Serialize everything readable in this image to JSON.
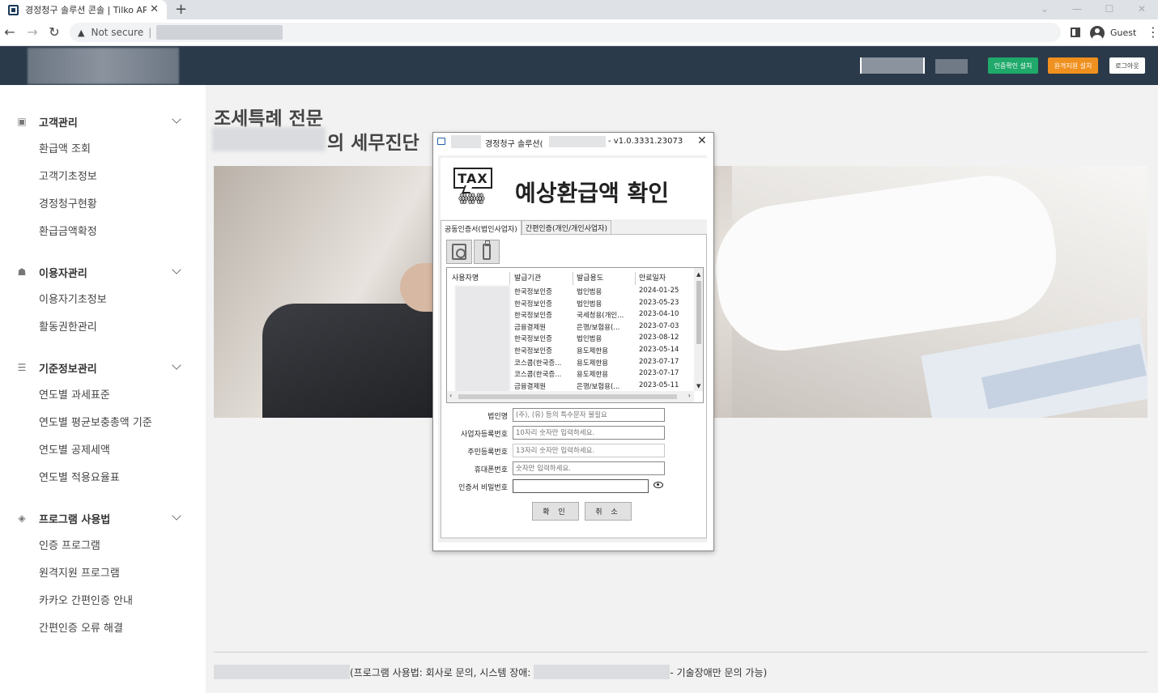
{
  "browser": {
    "tab_title": "경정청구 솔루션 콘솔 | Tilko API",
    "security_label": "Not secure",
    "profile_label": "Guest"
  },
  "header": {
    "buttons": {
      "cert_install": "인증확인 설치",
      "remote_install": "원격지원 설치",
      "logout": "로그아웃"
    },
    "colors": {
      "bg": "#2b3a4a",
      "green": "#1fa96a",
      "orange": "#f0901e"
    }
  },
  "sidebar": {
    "groups": [
      {
        "title": "고객관리",
        "icon": "person-icon",
        "items": [
          "환급액 조회",
          "고객기초정보",
          "경정청구현황",
          "환급금액확정"
        ]
      },
      {
        "title": "이용자관리",
        "icon": "users-icon",
        "items": [
          "이용자기초정보",
          "활동권한관리"
        ]
      },
      {
        "title": "기준정보관리",
        "icon": "list-icon",
        "items": [
          "연도별 과세표준",
          "연도별 평균보충총액 기준",
          "연도별 공제세액",
          "연도별 적용요율표"
        ]
      },
      {
        "title": "프로그램 사용법",
        "icon": "box-icon",
        "items": [
          "인증 프로그램",
          "원격지원 프로그램",
          "카카오 간편인증 안내",
          "간편인증 오류 해결"
        ]
      }
    ]
  },
  "main": {
    "title_line1": "조세특례 전문",
    "title_line2": "의 세무진단",
    "footer_mid": "(프로그램 사용법: 회사로 문의, 시스템 장애:",
    "footer_end": "- 기술장애만 문의 가능)"
  },
  "dialog": {
    "title": "경정청구 솔루션(",
    "version": "- v1.0.3331.23073",
    "logo_text": "TAX",
    "banner_title": "예상환급액 확인",
    "tabs": [
      "공동인증서(법인사업자)",
      "간편인증(개인/개인사업자)"
    ],
    "columns": [
      "사용자명",
      "발급기관",
      "발급용도",
      "만료일자"
    ],
    "certs": [
      {
        "issuer": "한국정보인증",
        "usage": "법인범용",
        "expiry": "2024-01-25"
      },
      {
        "issuer": "한국정보인증",
        "usage": "법인범용",
        "expiry": "2023-05-23"
      },
      {
        "issuer": "한국정보인증",
        "usage": "국세청용(개인...",
        "expiry": "2023-04-10"
      },
      {
        "issuer": "금융결제원",
        "usage": "은행/보험용(...",
        "expiry": "2023-07-03"
      },
      {
        "issuer": "한국정보인증",
        "usage": "법인범용",
        "expiry": "2023-08-12"
      },
      {
        "issuer": "한국정보인증",
        "usage": "용도제한용",
        "expiry": "2023-05-14"
      },
      {
        "issuer": "코스콤(한국증...",
        "usage": "용도제한용",
        "expiry": "2023-07-17"
      },
      {
        "issuer": "코스콤(한국증...",
        "usage": "용도제한용",
        "expiry": "2023-07-17"
      },
      {
        "issuer": "금융결제원",
        "usage": "은행/보험용(...",
        "expiry": "2023-05-11"
      }
    ],
    "form": {
      "corp_name": {
        "label": "법인명",
        "placeholder": "(주), (유) 등의 특수문자 불필요"
      },
      "biz_no": {
        "label": "사업자등록번호",
        "placeholder": "10자리 숫자만 입력하세요."
      },
      "rrn": {
        "label": "주민등록번호",
        "placeholder": "13자리 숫자만 입력하세요."
      },
      "phone": {
        "label": "휴대폰번호",
        "placeholder": "숫자만 입력하세요."
      },
      "cert_pw": {
        "label": "인증서 비밀번호",
        "placeholder": ""
      }
    },
    "ok_label": "확 인",
    "cancel_label": "취 소"
  }
}
